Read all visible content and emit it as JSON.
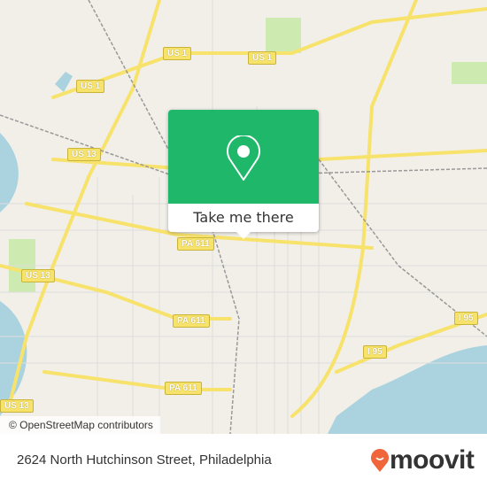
{
  "map": {
    "attribution": "© OpenStreetMap contributors",
    "shields": [
      {
        "label": "US 1"
      },
      {
        "label": "US 1"
      },
      {
        "label": "US 1"
      },
      {
        "label": "US 13"
      },
      {
        "label": "US 13"
      },
      {
        "label": "US 13"
      },
      {
        "label": "PA 611"
      },
      {
        "label": "PA 611"
      },
      {
        "label": "PA 611"
      },
      {
        "label": "I 95"
      },
      {
        "label": "I 95"
      }
    ],
    "colors": {
      "land": "#f2efe9",
      "water": "#aad3df",
      "park": "#cdebb0",
      "highway": "#f7e26b",
      "popup": "#1fb86a"
    }
  },
  "popup": {
    "button_label": "Take me there",
    "icon": "map-pin-icon"
  },
  "footer": {
    "address": "2624 North Hutchinson Street, Philadelphia",
    "brand": "moovit",
    "brand_color": "#f0653a"
  }
}
